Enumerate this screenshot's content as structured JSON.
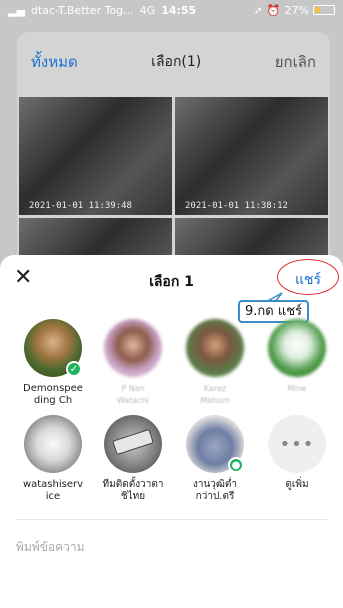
{
  "status": {
    "carrier": "dtac-T.Better Tog...",
    "network": "4G",
    "time": "14:55",
    "battery": "27%"
  },
  "background": {
    "all_label": "ทั้งหมด",
    "select_label": "เลือก(1)",
    "cancel_label": "ยกเลิก",
    "thumbs": [
      {
        "timestamp": "2021-01-01 11:39:48"
      },
      {
        "timestamp": "2021-01-01 11:38:12"
      },
      {
        "timestamp": ""
      },
      {
        "timestamp": ""
      }
    ]
  },
  "sheet": {
    "title": "เลือก 1",
    "share_label": "แชร์",
    "callout": "9.กด แชร์",
    "message_placeholder": "พิมพ์ข้อความ",
    "contacts": [
      {
        "name": "Demonspeeding Ch",
        "line1": "Demonspee",
        "line2": "ding Ch"
      },
      {
        "name": "P Nan Watachi",
        "line1": "P Nan",
        "line2": "Watachi"
      },
      {
        "name": "Karez Mahom",
        "line1": "Karez",
        "line2": "Mahom"
      },
      {
        "name": "Mine",
        "line1": "Mine",
        "line2": ""
      },
      {
        "name": "watashiservice",
        "line1": "watashiserv",
        "line2": "ice"
      },
      {
        "name": "ทีมติดตั้งวาตาชิไทย",
        "line1": "ทีมติดตั้งวาตา",
        "line2": "ชิไทย"
      },
      {
        "name": "งานวุฒิต่ำกว่าป.ตรี",
        "line1": "งานวุฒิต่ำ",
        "line2": "กว่าป.ตรี"
      },
      {
        "name": "ดูเพิ่ม",
        "line1": "ดูเพิ่ม",
        "line2": ""
      }
    ]
  },
  "colors": {
    "accent": "#1b6fd1",
    "badge_green": "#22b35e",
    "callout_border": "#3b8ec7",
    "highlight_red": "#e02a2a"
  }
}
